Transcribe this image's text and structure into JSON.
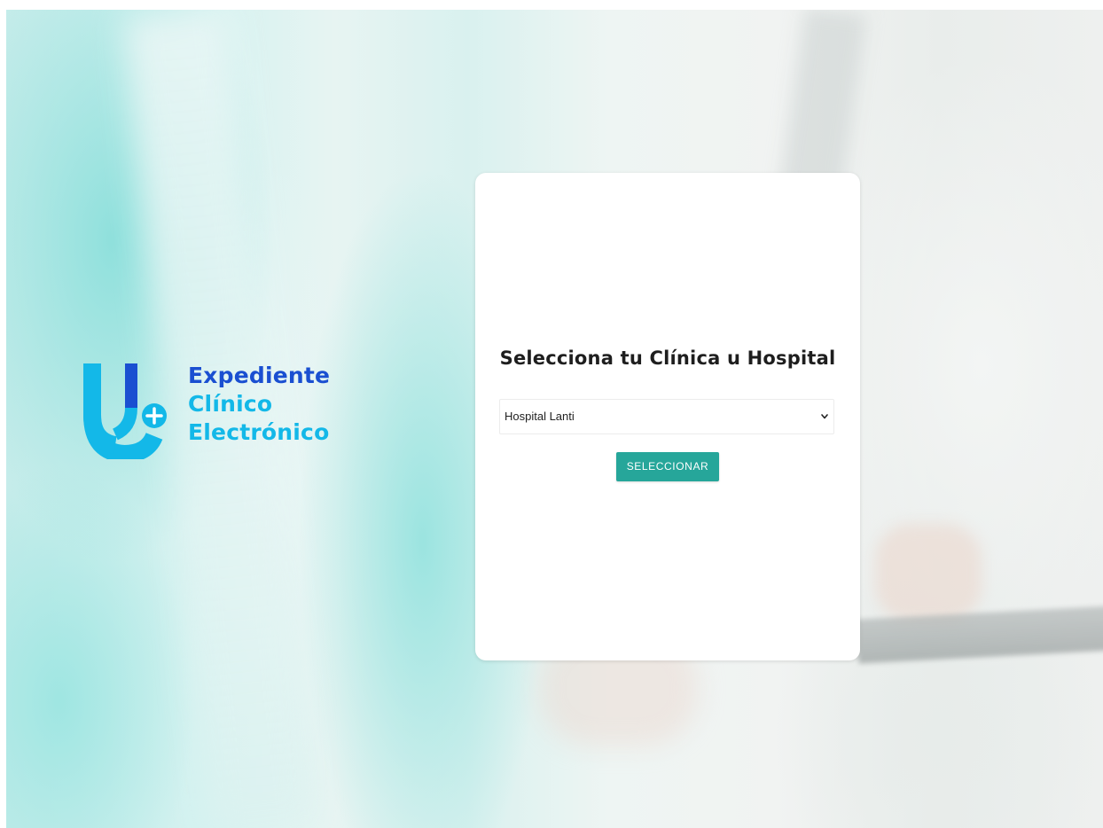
{
  "brand": {
    "logo_icon": "stethoscope-plus-icon",
    "line1": "Expediente",
    "line2": "Clínico",
    "line3": "Electrónico",
    "colors": {
      "dark_blue": "#1a4fd1",
      "light_blue": "#13b8e8"
    }
  },
  "card": {
    "title": "Selecciona tu Clínica u Hospital",
    "select": {
      "value": "Hospital Lanti",
      "chevron_icon": "chevron-down-icon"
    },
    "button": {
      "label": "SELECCIONAR",
      "color": "#26a69a"
    }
  }
}
